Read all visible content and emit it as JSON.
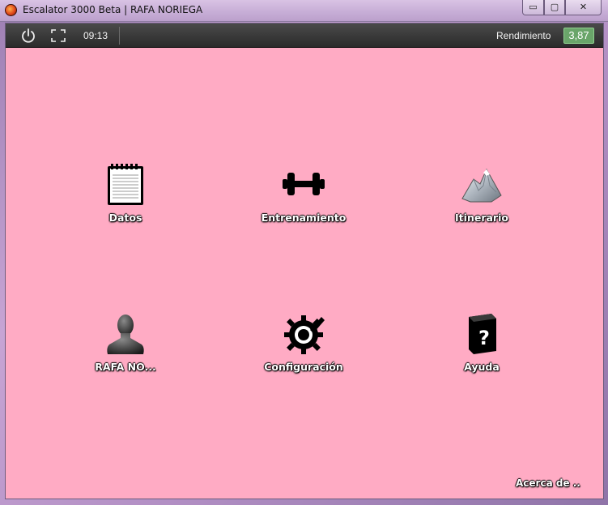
{
  "window": {
    "title": "Escalator 3000 Beta | RAFA NORIEGA",
    "minimize_glyph": "▭",
    "maximize_glyph": "▢",
    "close_glyph": "✕"
  },
  "toolbar": {
    "clock": "09:13",
    "rendimiento_label": "Rendimiento",
    "rendimiento_value": "3,87",
    "power_icon": "power-icon",
    "fullscreen_icon": "fullscreen-icon"
  },
  "tiles": {
    "datos": {
      "label": "Datos",
      "icon": "notepad-icon"
    },
    "entrenamiento": {
      "label": "Entrenamiento",
      "icon": "dumbbell-icon"
    },
    "itinerario": {
      "label": "Itinerario",
      "icon": "mountain-icon"
    },
    "usuario": {
      "label": "RAFA NO...",
      "icon": "user-icon"
    },
    "configuracion": {
      "label": "Configuración",
      "icon": "gear-icon"
    },
    "ayuda": {
      "label": "Ayuda",
      "icon": "help-book-icon"
    }
  },
  "footer": {
    "about_label": "Acerca de .."
  },
  "colors": {
    "background": "#ffabc4",
    "toolbar": "#333333",
    "rendimiento_badge": "#6aa56a"
  }
}
